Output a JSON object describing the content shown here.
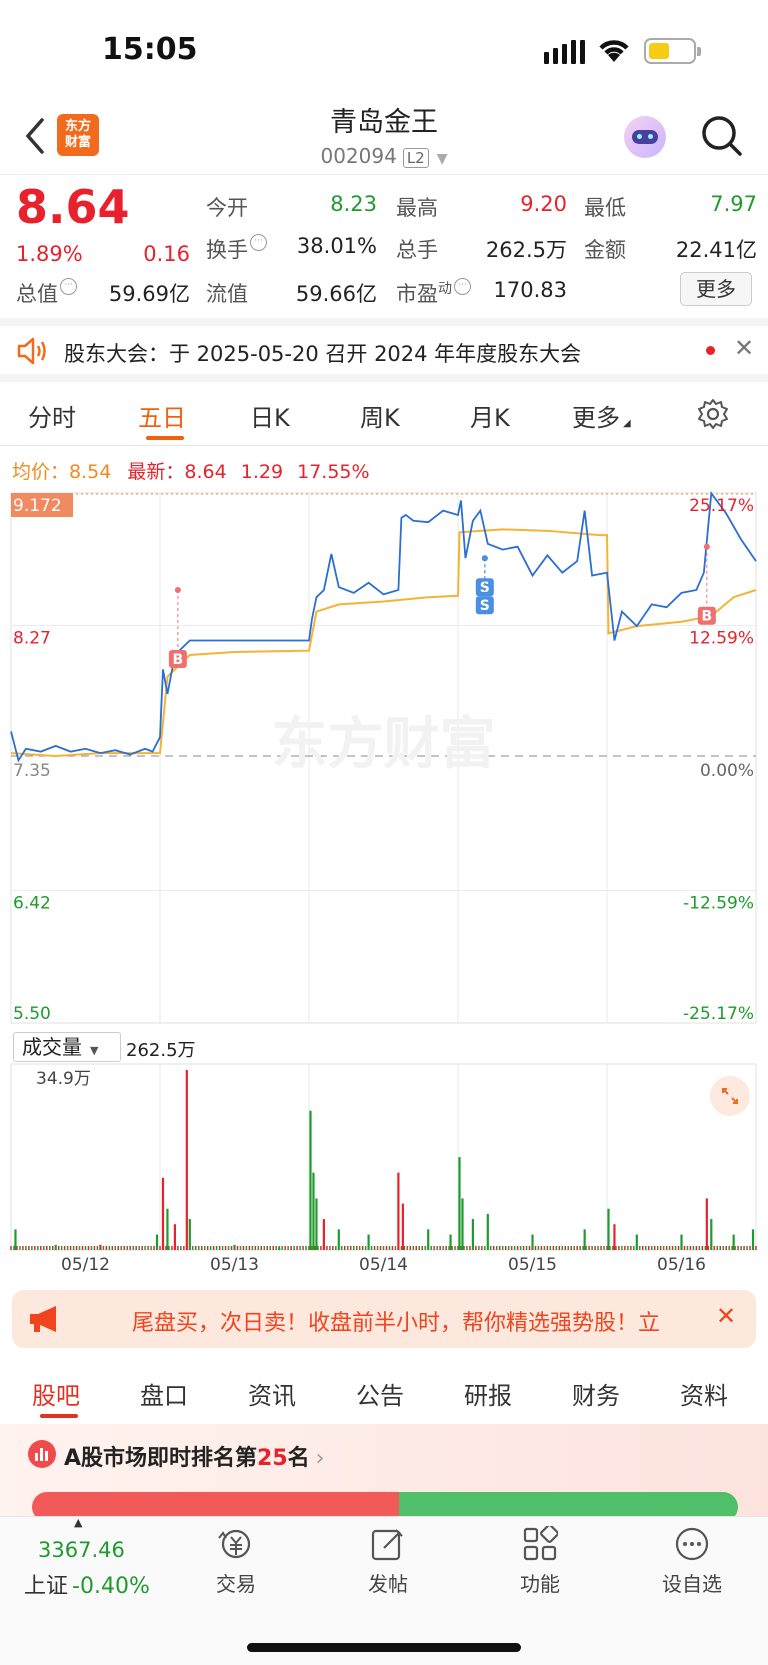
{
  "status": {
    "time": "15:05"
  },
  "header": {
    "logo_text": "东方财富",
    "title": "青岛金王",
    "code": "002094",
    "level_badge": "L2"
  },
  "quote": {
    "price": "8.64",
    "change_pct": "1.89%",
    "change_abs": "0.16",
    "open_label": "今开",
    "open": "8.23",
    "high_label": "最高",
    "high": "9.20",
    "low_label": "最低",
    "low": "7.97",
    "turnover_label": "换手",
    "turnover": "38.01%",
    "volume_label": "总手",
    "volume": "262.5万",
    "amount_label": "金额",
    "amount": "22.41亿",
    "total_mv_label": "总值",
    "total_mv": "59.69亿",
    "float_mv_label": "流值",
    "float_mv": "59.66亿",
    "pe_label": "市盈",
    "pe_sup": "动",
    "pe": "170.83",
    "more_button": "更多"
  },
  "notice": {
    "text": "股东大会：于 2025-05-20 召开 2024 年年度股东大会"
  },
  "chart_tabs": [
    "分时",
    "五日",
    "日K",
    "周K",
    "月K",
    "更多"
  ],
  "chart_header": {
    "avg_label": "均价：",
    "avg": "8.54",
    "last_label": "最新：",
    "last": "8.64",
    "last_change": "1.29",
    "last_pct": "17.55%"
  },
  "chart_data": {
    "type": "line",
    "watermark": "东方财富",
    "y_ticks_left": [
      "9.172",
      "8.27",
      "7.35",
      "6.42",
      "5.50"
    ],
    "y_ticks_right": [
      "25.17%",
      "12.59%",
      "0.00%",
      "-12.59%",
      "-25.17%"
    ],
    "x_days": [
      "05/12",
      "05/13",
      "05/14",
      "05/15",
      "05/16"
    ],
    "ylim": [
      5.5,
      9.172
    ],
    "prev_close": 7.35,
    "price_series": {
      "name": "price",
      "x": [
        0,
        0.05,
        0.1,
        0.2,
        0.3,
        0.4,
        0.5,
        0.6,
        0.7,
        0.8,
        0.9,
        0.95,
        1.0,
        1.02,
        1.05,
        1.1,
        1.2,
        1.5,
        1.8,
        2.0,
        2.02,
        2.05,
        2.1,
        2.15,
        2.2,
        2.3,
        2.4,
        2.5,
        2.6,
        2.62,
        2.65,
        2.7,
        2.8,
        2.9,
        3.0,
        3.02,
        3.05,
        3.1,
        3.15,
        3.2,
        3.3,
        3.4,
        3.5,
        3.6,
        3.7,
        3.8,
        3.85,
        3.9,
        4.0,
        4.05,
        4.1,
        4.2,
        4.3,
        4.4,
        4.5,
        4.6,
        4.65,
        4.7,
        4.8,
        4.9,
        5.0
      ],
      "y": [
        7.52,
        7.32,
        7.4,
        7.38,
        7.42,
        7.38,
        7.4,
        7.37,
        7.39,
        7.36,
        7.4,
        7.38,
        7.48,
        7.95,
        7.78,
        8.05,
        8.15,
        8.15,
        8.15,
        8.15,
        8.3,
        8.45,
        8.5,
        8.75,
        8.52,
        8.48,
        8.55,
        8.47,
        8.5,
        9.0,
        9.02,
        8.98,
        8.97,
        9.05,
        9.02,
        9.12,
        8.72,
        8.98,
        9.05,
        8.82,
        8.78,
        8.8,
        8.6,
        8.74,
        8.62,
        8.7,
        9.05,
        8.6,
        8.62,
        8.15,
        8.35,
        8.25,
        8.4,
        8.38,
        8.48,
        8.5,
        8.62,
        9.17,
        9.03,
        8.85,
        8.7
      ]
    },
    "avg_series": {
      "name": "avg",
      "x": [
        0,
        0.3,
        0.6,
        1.0,
        1.05,
        1.2,
        1.5,
        2.0,
        2.05,
        2.2,
        2.5,
        2.8,
        3.0,
        3.01,
        3.3,
        3.6,
        3.95,
        4.0,
        4.01,
        4.2,
        4.5,
        4.7,
        4.85,
        5.0
      ],
      "y": [
        7.37,
        7.35,
        7.37,
        7.37,
        7.9,
        8.05,
        8.07,
        8.08,
        8.35,
        8.4,
        8.42,
        8.45,
        8.46,
        8.9,
        8.92,
        8.91,
        8.88,
        8.88,
        8.2,
        8.25,
        8.28,
        8.32,
        8.45,
        8.5
      ]
    },
    "markers": [
      {
        "label": "B",
        "day": 1.12,
        "price": 8.5
      },
      {
        "label": "S",
        "day": 3.18,
        "price": 8.72
      },
      {
        "label": "S",
        "day": 3.18,
        "price": 8.72
      },
      {
        "label": "B",
        "day": 4.67,
        "price": 8.8
      }
    ],
    "volume": {
      "label": "成交量",
      "total": "262.5万",
      "max_label": "34.9万",
      "ylim": [
        0,
        34.9
      ],
      "bars": [
        {
          "x": 0.03,
          "v": 4,
          "c": "green"
        },
        {
          "x": 0.3,
          "v": 1,
          "c": "green"
        },
        {
          "x": 0.6,
          "v": 1,
          "c": "red"
        },
        {
          "x": 0.98,
          "v": 3,
          "c": "green"
        },
        {
          "x": 1.02,
          "v": 14,
          "c": "red"
        },
        {
          "x": 1.05,
          "v": 8,
          "c": "green"
        },
        {
          "x": 1.1,
          "v": 5,
          "c": "red"
        },
        {
          "x": 1.18,
          "v": 34.9,
          "c": "red"
        },
        {
          "x": 1.2,
          "v": 6,
          "c": "green"
        },
        {
          "x": 1.5,
          "v": 1,
          "c": "green"
        },
        {
          "x": 1.8,
          "v": 0.5,
          "c": "green"
        },
        {
          "x": 2.01,
          "v": 27,
          "c": "green"
        },
        {
          "x": 2.03,
          "v": 15,
          "c": "green"
        },
        {
          "x": 2.05,
          "v": 10,
          "c": "green"
        },
        {
          "x": 2.1,
          "v": 6,
          "c": "red"
        },
        {
          "x": 2.2,
          "v": 4,
          "c": "green"
        },
        {
          "x": 2.4,
          "v": 3,
          "c": "green"
        },
        {
          "x": 2.6,
          "v": 15,
          "c": "red"
        },
        {
          "x": 2.63,
          "v": 9,
          "c": "red"
        },
        {
          "x": 2.8,
          "v": 4,
          "c": "green"
        },
        {
          "x": 2.95,
          "v": 3,
          "c": "green"
        },
        {
          "x": 3.01,
          "v": 18,
          "c": "green"
        },
        {
          "x": 3.03,
          "v": 10,
          "c": "green"
        },
        {
          "x": 3.1,
          "v": 6,
          "c": "green"
        },
        {
          "x": 3.2,
          "v": 7,
          "c": "green"
        },
        {
          "x": 3.5,
          "v": 3,
          "c": "green"
        },
        {
          "x": 3.85,
          "v": 4,
          "c": "green"
        },
        {
          "x": 4.01,
          "v": 8,
          "c": "green"
        },
        {
          "x": 4.05,
          "v": 5,
          "c": "red"
        },
        {
          "x": 4.2,
          "v": 3,
          "c": "green"
        },
        {
          "x": 4.5,
          "v": 3,
          "c": "green"
        },
        {
          "x": 4.67,
          "v": 10,
          "c": "red"
        },
        {
          "x": 4.7,
          "v": 6,
          "c": "green"
        },
        {
          "x": 4.85,
          "v": 3,
          "c": "green"
        },
        {
          "x": 4.98,
          "v": 4,
          "c": "green"
        }
      ]
    }
  },
  "banner": {
    "text": "尾盘买，次日卖！收盘前半小时，帮你精选强势股！立"
  },
  "bottom_tabs": [
    "股吧",
    "盘口",
    "资讯",
    "公告",
    "研报",
    "财务",
    "资料"
  ],
  "ranking": {
    "prefix": "A股市场即时排名第",
    "rank": "25",
    "suffix": "名"
  },
  "nav": {
    "index_value": "3367.46",
    "index_name": "上证",
    "index_change": "-0.40%",
    "items": [
      "交易",
      "发帖",
      "功能",
      "设自选"
    ]
  },
  "colors": {
    "up": "#e8222c",
    "down": "#1f9b2e",
    "accent": "#f0600f",
    "avg_line": "#f5b335",
    "price_line": "#2a6fd1"
  }
}
